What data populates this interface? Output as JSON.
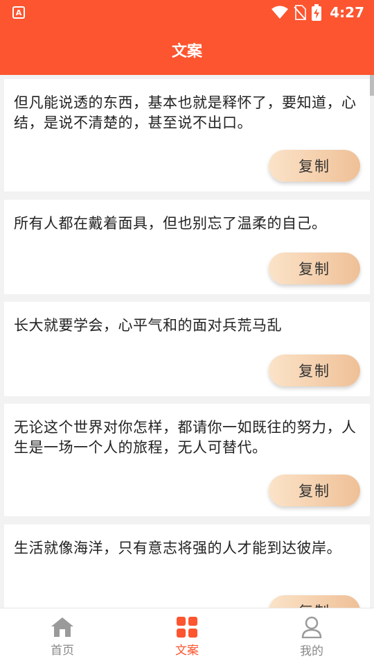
{
  "status_bar": {
    "app_badge": "A",
    "time": "4:27",
    "icons": [
      "wifi-icon",
      "no-sim-icon",
      "battery-charging-icon"
    ]
  },
  "header": {
    "title": "文案"
  },
  "cards": [
    {
      "text": "但凡能说透的东西，基本也就是释怀了，要知道，心结，是说不清楚的，甚至说不出口。",
      "button": "复制"
    },
    {
      "text": "所有人都在戴着面具，但也别忘了温柔的自己。",
      "button": "复制"
    },
    {
      "text": "长大就要学会，心平气和的面对兵荒马乱",
      "button": "复制"
    },
    {
      "text": "无论这个世界对你怎样，都请你一如既往的努力，人生是一场一个人的旅程，无人可替代。",
      "button": "复制"
    },
    {
      "text": "生活就像海洋，只有意志将强的人才能到达彼岸。",
      "button": "复制"
    }
  ],
  "bottom_nav": {
    "items": [
      {
        "label": "首页",
        "icon": "home-icon",
        "active": false
      },
      {
        "label": "文案",
        "icon": "grid-icon",
        "active": true
      },
      {
        "label": "我的",
        "icon": "user-icon",
        "active": false
      }
    ]
  },
  "colors": {
    "accent": "#fc5530",
    "button_gradient_start": "#fbe3c8",
    "button_gradient_end": "#efc097",
    "nav_inactive": "#888888"
  }
}
